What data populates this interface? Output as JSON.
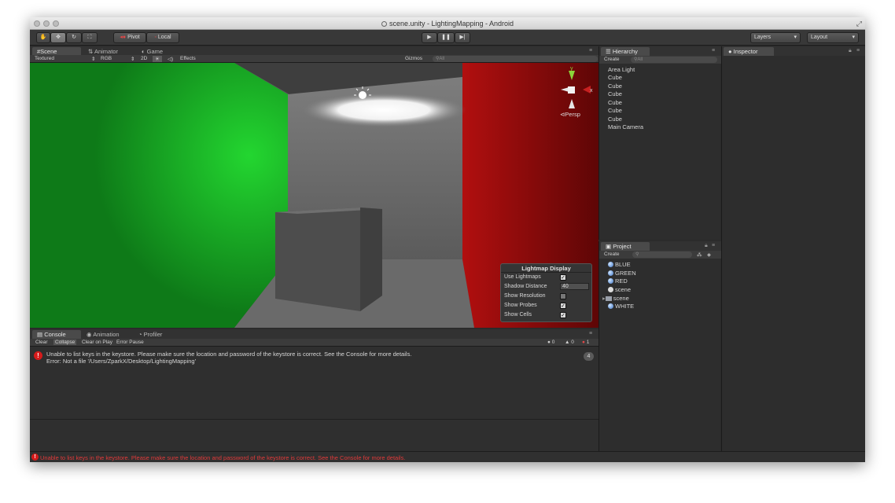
{
  "window": {
    "title": "scene.unity - LightingMapping - Android"
  },
  "toolbar": {
    "pivot_label": "Pivot",
    "local_label": "Local",
    "layers_label": "Layers",
    "layout_label": "Layout"
  },
  "scene_view": {
    "tabs": [
      "Scene",
      "Animator",
      "Game"
    ],
    "shading_mode": "Textured",
    "render_mode": "RGB",
    "mode_2d": "2D",
    "effects_label": "Effects",
    "gizmos_label": "Gizmos",
    "search_placeholder": "All",
    "persp_label": "Persp",
    "colors": {
      "left_wall": "#0f8a1a",
      "right_wall": "#8b0b0b",
      "floor": "#5b5b5b"
    }
  },
  "lightmap_display": {
    "title": "Lightmap Display",
    "rows": [
      {
        "label": "Use Lightmaps",
        "checked": true
      },
      {
        "label": "Shadow Distance",
        "value": "40"
      },
      {
        "label": "Show Resolution",
        "checked": false
      },
      {
        "label": "Show Probes",
        "checked": true
      },
      {
        "label": "Show Cells",
        "checked": true
      }
    ]
  },
  "console": {
    "tabs": [
      "Console",
      "Animation",
      "Profiler"
    ],
    "buttons": [
      "Clear",
      "Collapse",
      "Clear on Play",
      "Error Pause"
    ],
    "info_count": "0",
    "warn_count": "0",
    "error_count": "1",
    "message_line1": "Unable to list keys in the keystore. Please make sure the location and password of the keystore is correct. See the Console for more details.",
    "message_line2": "Error: Not a file '/Users/ZparkX/Desktop/LightingMapping'",
    "repeat_count": "4"
  },
  "hierarchy": {
    "title": "Hierarchy",
    "create_label": "Create",
    "search_placeholder": "All",
    "items": [
      "Area Light",
      "Cube",
      "Cube",
      "Cube",
      "Cube",
      "Cube",
      "Cube",
      "Main Camera"
    ]
  },
  "project": {
    "title": "Project",
    "create_label": "Create",
    "items": [
      {
        "label": "BLUE",
        "icon": "material-ball-icon"
      },
      {
        "label": "GREEN",
        "icon": "material-ball-icon"
      },
      {
        "label": "RED",
        "icon": "material-ball-icon"
      },
      {
        "label": "scene",
        "icon": "unity-scene-icon"
      },
      {
        "label": "scene",
        "icon": "folder-icon"
      },
      {
        "label": "WHITE",
        "icon": "material-ball-icon"
      }
    ]
  },
  "inspector": {
    "title": "Inspector"
  },
  "status": {
    "message": "Unable to list keys in the keystore. Please make sure the location and password of the keystore is correct. See the Console for more details."
  }
}
